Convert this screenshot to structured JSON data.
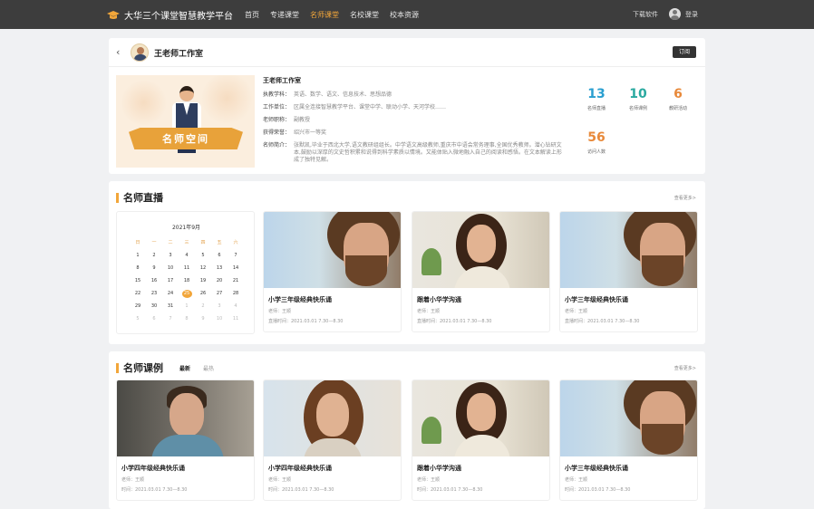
{
  "topbar": {
    "title": "大华三个课堂智慧教学平台",
    "nav": [
      {
        "label": "首页",
        "active": false
      },
      {
        "label": "专递课堂",
        "active": false
      },
      {
        "label": "名师课堂",
        "active": true
      },
      {
        "label": "名校课堂",
        "active": false
      },
      {
        "label": "校本资源",
        "active": false
      }
    ],
    "download": "下载软件",
    "login": "登录"
  },
  "studio": {
    "name": "王老师工作室",
    "subscribe": "订阅",
    "banner_text": "名师空间",
    "info_title": "王老师工作室",
    "fields": [
      {
        "key": "执教学科：",
        "value": "英语、数学、语文、信息技术、思想品德"
      },
      {
        "key": "工作单位：",
        "value": "区属全连接智慧教学平台、课堂中学、联动小学、天河学校……"
      },
      {
        "key": "老师职称：",
        "value": "副教授"
      },
      {
        "key": "获得荣誉：",
        "value": "绍兴市一等奖"
      },
      {
        "key": "名师简介：",
        "value": "张默凯,毕业于西北大学,语文教研组组长。中学语文高级教师,重庆市中语会常务理事,全国优秀教师。潜心钻研文本,鼓励以深厚的文史哲积累和说得到科学素质以情境。又能体贴入微地融入自己的阅读和感悟。在文本解读上形成了独特见解。"
      }
    ],
    "stats": [
      {
        "value": "13",
        "label": "名师直播",
        "color": "#2a9fd0"
      },
      {
        "value": "10",
        "label": "名师课例",
        "color": "#2aa9a0"
      },
      {
        "value": "6",
        "label": "教研活动",
        "color": "#e8893a"
      },
      {
        "value": "56",
        "label": "访问人数",
        "color": "#e8893a"
      }
    ]
  },
  "live": {
    "title": "名师直播",
    "more": "查看更多>",
    "calendar": {
      "title": "2021年9月",
      "weekdays": [
        "日",
        "一",
        "二",
        "三",
        "四",
        "五",
        "六"
      ],
      "days": [
        "1",
        "2",
        "3",
        "4",
        "5",
        "6",
        "7",
        "8",
        "9",
        "10",
        "11",
        "12",
        "13",
        "14",
        "15",
        "16",
        "17",
        "18",
        "19",
        "20",
        "21",
        "22",
        "23",
        "24",
        "25",
        "26",
        "27",
        "28",
        "29",
        "30",
        "31",
        "1",
        "2",
        "3",
        "4",
        "5",
        "6",
        "7",
        "8",
        "9",
        "10",
        "11"
      ],
      "selected": "25"
    },
    "cards": [
      {
        "title": "小学三年级经典快乐诵",
        "teacher": "老师：王顺",
        "time": "直播时间：2021.03.01  7.30—8.30",
        "photo": "man"
      },
      {
        "title": "跟着小华学沟通",
        "teacher": "老师：王顺",
        "time": "直播时间：2021.03.01  7.30—8.30",
        "photo": "woman"
      },
      {
        "title": "小学三年级经典快乐诵",
        "teacher": "老师：王顺",
        "time": "直播时间：2021.03.01  7.30—8.30",
        "photo": "man"
      }
    ]
  },
  "cases": {
    "title": "名师课例",
    "tabs": [
      {
        "label": "最新",
        "active": true
      },
      {
        "label": "最热",
        "active": false
      }
    ],
    "more": "查看更多>",
    "cards": [
      {
        "title": "小学四年级经典快乐诵",
        "teacher": "老师：王顺",
        "time": "时间：2021.03.01  7.30—8.30",
        "photo": "guy"
      },
      {
        "title": "小学四年级经典快乐诵",
        "teacher": "老师：王顺",
        "time": "时间：2021.03.01  7.30—8.30",
        "photo": "curly"
      },
      {
        "title": "跟着小华学沟通",
        "teacher": "老师：王顺",
        "time": "时间：2021.03.01  7.30—8.30",
        "photo": "woman"
      },
      {
        "title": "小学三年级经典快乐诵",
        "teacher": "老师：王顺",
        "time": "时间：2021.03.01  7.30—8.30",
        "photo": "man"
      }
    ]
  }
}
